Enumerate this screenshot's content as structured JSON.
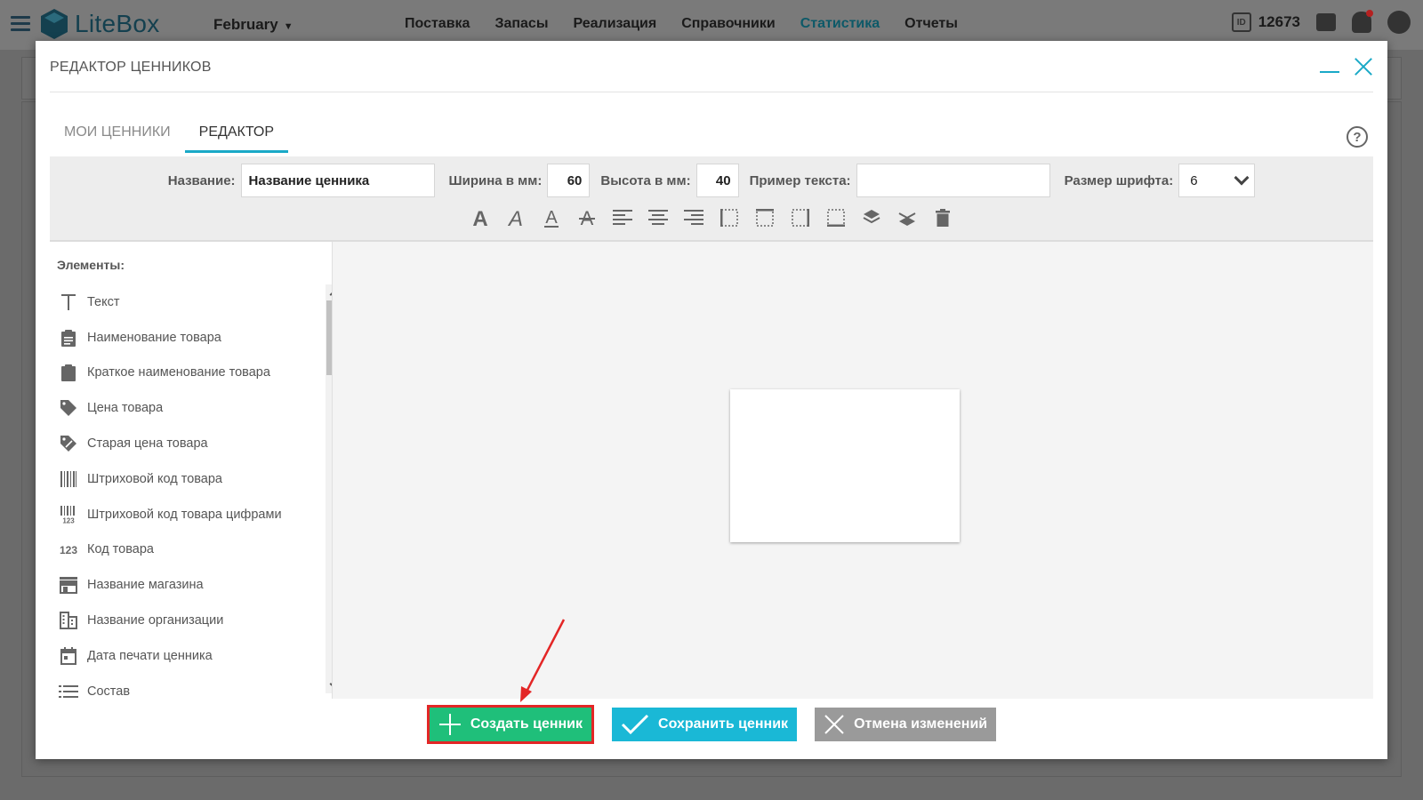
{
  "app": {
    "logo_text": "LiteBox",
    "period": "February",
    "nav": [
      "Поставка",
      "Запасы",
      "Реализация",
      "Справочники",
      "Статистика",
      "Отчеты"
    ],
    "nav_active_index": 4,
    "user_id": "12673"
  },
  "modal": {
    "title": "РЕДАКТОР ЦЕННИКОВ",
    "tabs": [
      {
        "label": "МОИ ЦЕННИКИ",
        "active": false
      },
      {
        "label": "РЕДАКТОР",
        "active": true
      }
    ]
  },
  "toolbar": {
    "name_label": "Название:",
    "name_value": "Название ценника",
    "width_label": "Ширина в мм:",
    "width_value": "60",
    "height_label": "Высота в мм:",
    "height_value": "40",
    "sample_label": "Пример текста:",
    "sample_value": "",
    "font_size_label": "Размер шрифта:",
    "font_size_value": "6",
    "tools": [
      "bold-icon",
      "italic-icon",
      "underline-icon",
      "strikethrough-icon",
      "align-left-icon",
      "align-center-icon",
      "align-right-icon",
      "border-left-icon",
      "border-top-icon",
      "border-right-icon",
      "border-bottom-icon",
      "bring-forward-icon",
      "send-backward-icon",
      "delete-icon"
    ]
  },
  "elements": {
    "title": "Элементы:",
    "items": [
      {
        "label": "Текст",
        "icon": "text-icon"
      },
      {
        "label": "Наименование товара",
        "icon": "clipboard-list-icon"
      },
      {
        "label": "Краткое наименование товара",
        "icon": "clipboard-icon"
      },
      {
        "label": "Цена товара",
        "icon": "tag-icon"
      },
      {
        "label": "Старая цена товара",
        "icon": "discount-tag-icon"
      },
      {
        "label": "Штриховой код товара",
        "icon": "barcode-icon"
      },
      {
        "label": "Штриховой код товара цифрами",
        "icon": "barcode-digits-icon"
      },
      {
        "label": "Код товара",
        "icon": "numbers-icon"
      },
      {
        "label": "Название магазина",
        "icon": "store-icon"
      },
      {
        "label": "Название организации",
        "icon": "building-icon"
      },
      {
        "label": "Дата печати ценника",
        "icon": "calendar-icon"
      },
      {
        "label": "Состав",
        "icon": "list-icon"
      }
    ]
  },
  "footer": {
    "create_label": "Создать ценник",
    "save_label": "Сохранить ценник",
    "cancel_label": "Отмена изменений"
  },
  "colors": {
    "accent": "#1aa9c7",
    "create_button": "#1fbf7a",
    "save_button": "#1ab8d6",
    "cancel_button": "#9a9a9a",
    "highlight_border": "#e32626"
  }
}
